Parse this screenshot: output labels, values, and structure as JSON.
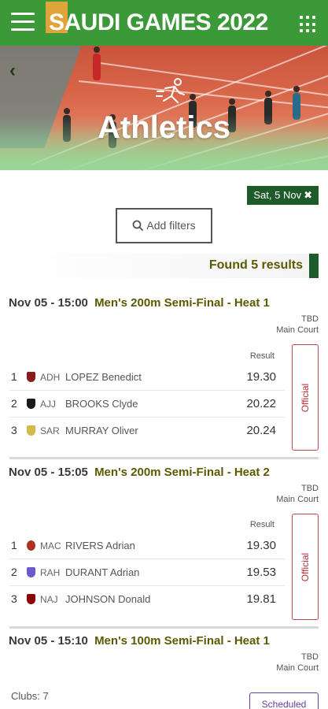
{
  "header": {
    "brand": "SAUDI GAMES 2022"
  },
  "hero": {
    "title": "Athletics"
  },
  "date_filter": {
    "label": "Sat, 5 Nov",
    "clear": "✖"
  },
  "filters": {
    "label": "Add filters"
  },
  "results": {
    "found_label": "Found 5 results"
  },
  "events": [
    {
      "datetime": "Nov 05 - 15:00",
      "name": "Men's 200m Semi-Final - Heat 1",
      "venue_line1": "TBD",
      "venue_line2": "Main Court",
      "result_header": "Result",
      "status": "Official",
      "rows": [
        {
          "rank": "1",
          "club": "ADH",
          "name": "LOPEZ Benedict",
          "result": "19.30",
          "shield_color": "#8b1a1a"
        },
        {
          "rank": "2",
          "club": "AJJ",
          "name": "BROOKS Clyde",
          "result": "20.22",
          "shield_color": "#1a1a1a"
        },
        {
          "rank": "3",
          "club": "SAR",
          "name": "MURRAY Oliver",
          "result": "20.24",
          "shield_color": "#d4b84a"
        }
      ]
    },
    {
      "datetime": "Nov 05 - 15:05",
      "name": "Men's 200m Semi-Final - Heat 2",
      "venue_line1": "TBD",
      "venue_line2": "Main Court",
      "result_header": "Result",
      "status": "Official",
      "rows": [
        {
          "rank": "1",
          "club": "MAC",
          "name": "RIVERS Adrian",
          "result": "19.30",
          "shield_color": "#b03020"
        },
        {
          "rank": "2",
          "club": "RAH",
          "name": "DURANT Adrian",
          "result": "19.53",
          "shield_color": "#6a5acd"
        },
        {
          "rank": "3",
          "club": "NAJ",
          "name": "JOHNSON Donald",
          "result": "19.81",
          "shield_color": "#8b0000"
        }
      ]
    },
    {
      "datetime": "Nov 05 - 15:10",
      "name": "Men's 100m Semi-Final - Heat 1",
      "venue_line1": "TBD",
      "venue_line2": "Main Court",
      "clubs_label": "Clubs: 7",
      "status": "Scheduled"
    }
  ],
  "colors": {
    "header_green": "#3b9a37",
    "accent_dark_green": "#1f5a2a",
    "event_title_olive": "#5c5a00",
    "official_red": "#b5303a",
    "scheduled_purple": "#6a3aa6"
  }
}
